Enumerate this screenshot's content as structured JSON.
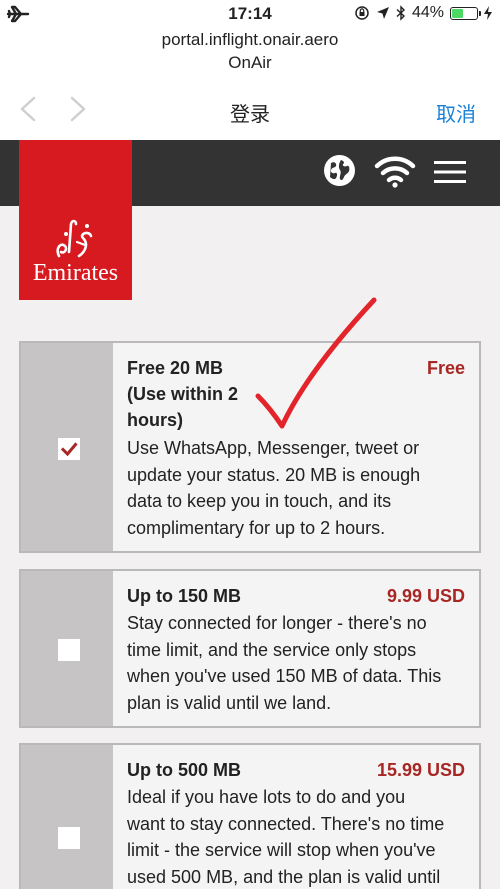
{
  "status": {
    "time": "17:14",
    "battery": "44%",
    "battery_level": 0.44
  },
  "browser": {
    "url": "portal.inflight.onair.aero",
    "site_name": "OnAir"
  },
  "nav": {
    "title": "登录",
    "cancel_label": "取消"
  },
  "brand": {
    "logo_text": "Emirates",
    "color": "#d71920"
  },
  "plans": [
    {
      "name_lines": [
        "Free 20 MB",
        "(Use within 2",
        "hours)"
      ],
      "price": "Free",
      "checked": true,
      "description_lines": [
        "Use WhatsApp, Messenger, tweet or",
        "update your status. 20 MB is enough",
        "data to keep you in touch, and its",
        "complimentary for up to 2 hours."
      ]
    },
    {
      "name_lines": [
        "Up to 150 MB"
      ],
      "price": "9.99 USD",
      "checked": false,
      "description_lines": [
        "Stay connected for longer - there's no",
        "time limit, and the service only stops",
        "when you've used 150 MB of data. This",
        "plan is valid until we land."
      ]
    },
    {
      "name_lines": [
        "Up to 500 MB"
      ],
      "price": "15.99 USD",
      "checked": false,
      "description_lines": [
        "Ideal if you have lots to do and you",
        "want to stay connected. There's no time",
        "limit - the service will stop when you've",
        "used 500 MB, and the plan is valid until"
      ]
    }
  ],
  "colors": {
    "price": "#a72724",
    "accent_blue": "#1a82d8",
    "annotation_red": "#e3242b"
  }
}
